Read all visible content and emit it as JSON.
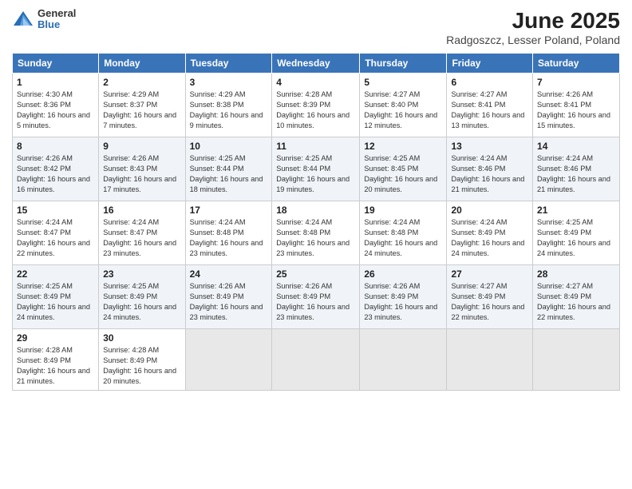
{
  "logo": {
    "general": "General",
    "blue": "Blue"
  },
  "title": "June 2025",
  "subtitle": "Radgoszcz, Lesser Poland, Poland",
  "days_header": [
    "Sunday",
    "Monday",
    "Tuesday",
    "Wednesday",
    "Thursday",
    "Friday",
    "Saturday"
  ],
  "weeks": [
    [
      {
        "day": "1",
        "sunrise": "4:30 AM",
        "sunset": "8:36 PM",
        "daylight": "16 hours and 5 minutes."
      },
      {
        "day": "2",
        "sunrise": "4:29 AM",
        "sunset": "8:37 PM",
        "daylight": "16 hours and 7 minutes."
      },
      {
        "day": "3",
        "sunrise": "4:29 AM",
        "sunset": "8:38 PM",
        "daylight": "16 hours and 9 minutes."
      },
      {
        "day": "4",
        "sunrise": "4:28 AM",
        "sunset": "8:39 PM",
        "daylight": "16 hours and 10 minutes."
      },
      {
        "day": "5",
        "sunrise": "4:27 AM",
        "sunset": "8:40 PM",
        "daylight": "16 hours and 12 minutes."
      },
      {
        "day": "6",
        "sunrise": "4:27 AM",
        "sunset": "8:41 PM",
        "daylight": "16 hours and 13 minutes."
      },
      {
        "day": "7",
        "sunrise": "4:26 AM",
        "sunset": "8:41 PM",
        "daylight": "16 hours and 15 minutes."
      }
    ],
    [
      {
        "day": "8",
        "sunrise": "4:26 AM",
        "sunset": "8:42 PM",
        "daylight": "16 hours and 16 minutes."
      },
      {
        "day": "9",
        "sunrise": "4:26 AM",
        "sunset": "8:43 PM",
        "daylight": "16 hours and 17 minutes."
      },
      {
        "day": "10",
        "sunrise": "4:25 AM",
        "sunset": "8:44 PM",
        "daylight": "16 hours and 18 minutes."
      },
      {
        "day": "11",
        "sunrise": "4:25 AM",
        "sunset": "8:44 PM",
        "daylight": "16 hours and 19 minutes."
      },
      {
        "day": "12",
        "sunrise": "4:25 AM",
        "sunset": "8:45 PM",
        "daylight": "16 hours and 20 minutes."
      },
      {
        "day": "13",
        "sunrise": "4:24 AM",
        "sunset": "8:46 PM",
        "daylight": "16 hours and 21 minutes."
      },
      {
        "day": "14",
        "sunrise": "4:24 AM",
        "sunset": "8:46 PM",
        "daylight": "16 hours and 21 minutes."
      }
    ],
    [
      {
        "day": "15",
        "sunrise": "4:24 AM",
        "sunset": "8:47 PM",
        "daylight": "16 hours and 22 minutes."
      },
      {
        "day": "16",
        "sunrise": "4:24 AM",
        "sunset": "8:47 PM",
        "daylight": "16 hours and 23 minutes."
      },
      {
        "day": "17",
        "sunrise": "4:24 AM",
        "sunset": "8:48 PM",
        "daylight": "16 hours and 23 minutes."
      },
      {
        "day": "18",
        "sunrise": "4:24 AM",
        "sunset": "8:48 PM",
        "daylight": "16 hours and 23 minutes."
      },
      {
        "day": "19",
        "sunrise": "4:24 AM",
        "sunset": "8:48 PM",
        "daylight": "16 hours and 24 minutes."
      },
      {
        "day": "20",
        "sunrise": "4:24 AM",
        "sunset": "8:49 PM",
        "daylight": "16 hours and 24 minutes."
      },
      {
        "day": "21",
        "sunrise": "4:25 AM",
        "sunset": "8:49 PM",
        "daylight": "16 hours and 24 minutes."
      }
    ],
    [
      {
        "day": "22",
        "sunrise": "4:25 AM",
        "sunset": "8:49 PM",
        "daylight": "16 hours and 24 minutes."
      },
      {
        "day": "23",
        "sunrise": "4:25 AM",
        "sunset": "8:49 PM",
        "daylight": "16 hours and 24 minutes."
      },
      {
        "day": "24",
        "sunrise": "4:26 AM",
        "sunset": "8:49 PM",
        "daylight": "16 hours and 23 minutes."
      },
      {
        "day": "25",
        "sunrise": "4:26 AM",
        "sunset": "8:49 PM",
        "daylight": "16 hours and 23 minutes."
      },
      {
        "day": "26",
        "sunrise": "4:26 AM",
        "sunset": "8:49 PM",
        "daylight": "16 hours and 23 minutes."
      },
      {
        "day": "27",
        "sunrise": "4:27 AM",
        "sunset": "8:49 PM",
        "daylight": "16 hours and 22 minutes."
      },
      {
        "day": "28",
        "sunrise": "4:27 AM",
        "sunset": "8:49 PM",
        "daylight": "16 hours and 22 minutes."
      }
    ],
    [
      {
        "day": "29",
        "sunrise": "4:28 AM",
        "sunset": "8:49 PM",
        "daylight": "16 hours and 21 minutes."
      },
      {
        "day": "30",
        "sunrise": "4:28 AM",
        "sunset": "8:49 PM",
        "daylight": "16 hours and 20 minutes."
      },
      null,
      null,
      null,
      null,
      null
    ]
  ]
}
